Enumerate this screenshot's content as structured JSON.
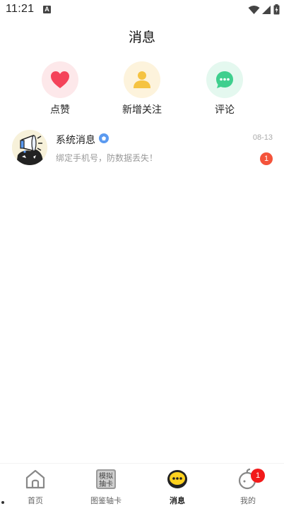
{
  "status_bar": {
    "time": "11:21",
    "notification_letter": "A"
  },
  "header": {
    "title": "消息"
  },
  "quick_entries": [
    {
      "label": "点赞",
      "icon": "heart-icon",
      "color": "#f4435a",
      "bg": "#fde8ea"
    },
    {
      "label": "新增关注",
      "icon": "person-icon",
      "color": "#f5c342",
      "bg": "#fdf3dc"
    },
    {
      "label": "评论",
      "icon": "chat-bubble-icon",
      "color": "#3fcf8e",
      "bg": "#e4f8ef"
    }
  ],
  "messages": [
    {
      "name": "系统消息",
      "preview": "绑定手机号，防数据丢失！",
      "date": "08-13",
      "unread": "1"
    }
  ],
  "tabbar": {
    "tabs": [
      {
        "label": "首页",
        "icon": "home-icon"
      },
      {
        "label": "图鉴轴卡",
        "icon": "card-icon",
        "icon_text": "模拟抽卡"
      },
      {
        "label": "消息",
        "icon": "message-icon",
        "active": true
      },
      {
        "label": "我的",
        "icon": "profile-icon"
      }
    ],
    "profile_badge": "1"
  },
  "colors": {
    "accent_yellow": "#ffd21f",
    "badge_red": "#f21a1a",
    "unread_orange": "#f4533a",
    "verify_blue": "#5b9af0"
  }
}
